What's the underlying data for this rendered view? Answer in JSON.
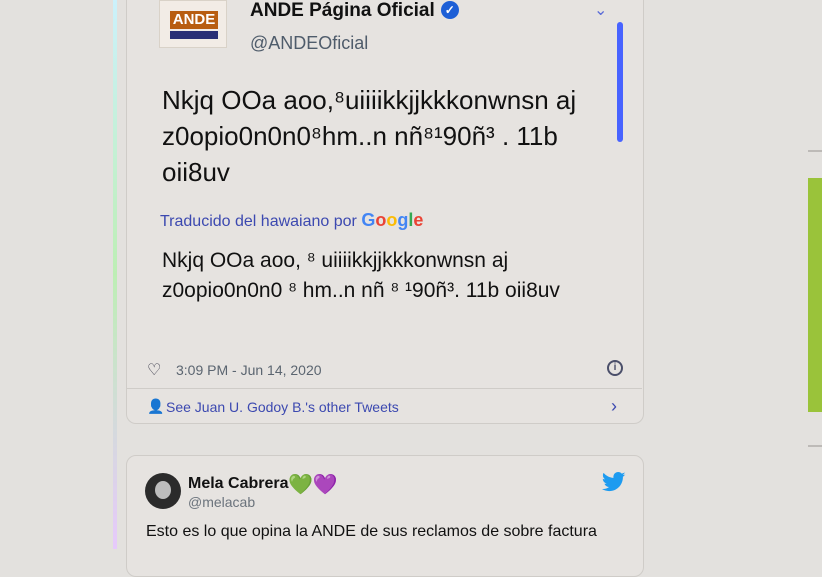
{
  "tweet1": {
    "account_name": "ANDE Página Oficial",
    "logo_text": "ANDE",
    "handle": "@ANDEOficial",
    "text": "Nkjq  OOa aoo,⁸uiiiikkjjkkkonwnsn aj z0opio0n0n0⁸hm..n nñ⁸¹90ñ³ . 11b oii8uv",
    "translation_prefix": "Traducido del hawaiano por",
    "translation_brand": [
      "G",
      "o",
      "o",
      "g",
      "l",
      "e"
    ],
    "translated_text": "Nkjq OOa aoo, ⁸ uiiiikkjjkkkonwnsn aj z0opio0n0n0 ⁸ hm..n nñ ⁸ ¹90ñ³. 11b oii8uv",
    "timestamp": "3:09 PM - Jun 14, 2020",
    "other_tweets_link": "See Juan U. Godoy B.'s other Tweets"
  },
  "tweet2": {
    "poster_name": "Mela Cabrera",
    "poster_emoji": [
      "💚",
      "💜"
    ],
    "poster_handle": "@melacab",
    "text": "Esto es lo que opina la ANDE de sus reclamos de sobre factura"
  },
  "icons": [
    "verified-badge-icon",
    "chevron-down-icon",
    "heart-icon",
    "info-icon",
    "user-icon",
    "chevron-right-icon",
    "twitter-bird-icon"
  ],
  "colors": {
    "link": "#3c49b0",
    "verified": "#1d5fd6",
    "twitter": "#1d9bf0"
  }
}
